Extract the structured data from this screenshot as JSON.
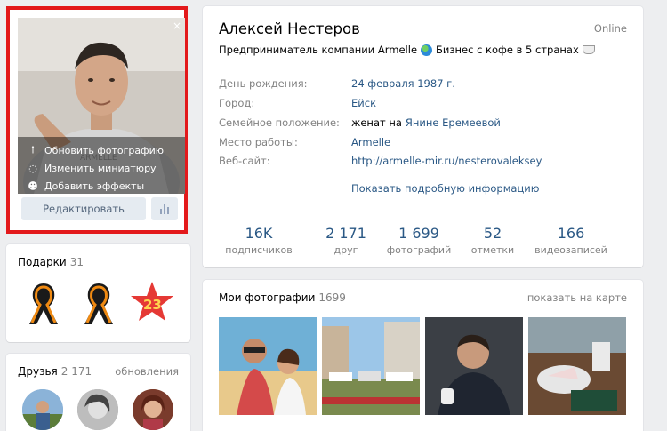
{
  "avatar": {
    "close": "×",
    "menu": [
      {
        "icon": "upload-arrow-icon",
        "glyph": "🠕",
        "label": "Обновить фотографию"
      },
      {
        "icon": "thumbnail-circle-icon",
        "glyph": "◌",
        "label": "Изменить миниатюру"
      },
      {
        "icon": "smile-icon",
        "glyph": "☻",
        "label": "Добавить эффекты"
      }
    ],
    "edit_label": "Редактировать"
  },
  "gifts": {
    "title": "Подарки",
    "count": "31"
  },
  "friends": {
    "title": "Друзья",
    "count": "2 171",
    "updates": "обновления"
  },
  "profile": {
    "name": "Алексей Нестеров",
    "online": "Online",
    "status_a": "Предприниматель компании Armelle",
    "status_b": "Бизнес с кофе в 5 странах",
    "info": [
      {
        "label": "День рождения:",
        "value": "24 февраля 1987 г.",
        "link": true
      },
      {
        "label": "Город:",
        "value": "Ейск",
        "link": true
      },
      {
        "label": "Семейное положение:",
        "value": "женат на",
        "extra": "Янине Еремеевой"
      },
      {
        "label": "Место работы:",
        "value": "Armelle",
        "link": true
      },
      {
        "label": "Веб-сайт:",
        "value": "http://armelle-mir.ru/nesterovaleksey",
        "link": true
      }
    ],
    "more": "Показать подробную информацию",
    "counters": [
      {
        "num": "16K",
        "label": "подписчиков"
      },
      {
        "num": "2 171",
        "label": "друг"
      },
      {
        "num": "1 699",
        "label": "фотографий"
      },
      {
        "num": "52",
        "label": "отметки"
      },
      {
        "num": "166",
        "label": "видеозаписей"
      }
    ]
  },
  "photos": {
    "title": "Мои фотографии",
    "count": "1699",
    "map_link": "показать на карте"
  },
  "colors": {
    "accent": "#2a5885",
    "highlight_border": "#e3191b",
    "background": "#edeef0"
  }
}
